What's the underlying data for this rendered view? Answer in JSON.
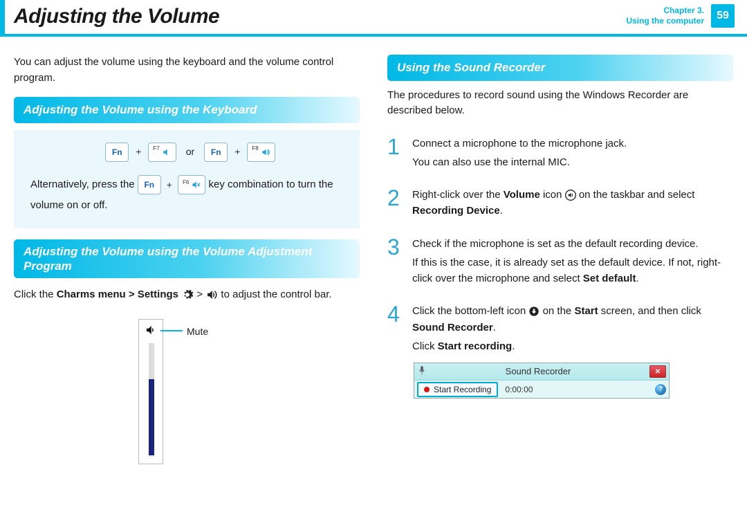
{
  "header": {
    "title": "Adjusting the Volume",
    "chapter_line1": "Chapter 3.",
    "chapter_line2": "Using the computer",
    "page_number": "59"
  },
  "left": {
    "intro": "You can adjust the volume using the keyboard and the volume control program.",
    "section1_title": "Adjusting the Volume using the Keyboard",
    "fn_label": "Fn",
    "f7_label": "F7",
    "f8_label": "F8",
    "f6_label": "F6",
    "or_label": "or",
    "plus": "+",
    "alt_prefix": "Alternatively, press the",
    "alt_suffix": "key combination to turn the volume on or off.",
    "section2_title": "Adjusting the Volume using the Volume Adjustment Program",
    "charms_prefix": "Click the ",
    "charms_bold": "Charms menu > Settings",
    "charms_sep": " > ",
    "charms_suffix": " to adjust the control bar.",
    "mute_label": "Mute"
  },
  "right": {
    "section_title": "Using the Sound Recorder",
    "intro": "The procedures to record sound using the Windows Recorder are described below.",
    "steps": {
      "s1_num": "1",
      "s1a": "Connect a microphone to the microphone jack.",
      "s1b": "You can also use the internal MIC.",
      "s2_num": "2",
      "s2_pre": "Right-click over the ",
      "s2_bold1": "Volume",
      "s2_mid": " icon ",
      "s2_post": " on the taskbar and select ",
      "s2_bold2": "Recording Device",
      "s2_end": ".",
      "s3_num": "3",
      "s3a": "Check if the microphone is set as the default recording device.",
      "s3b_pre": "If this is the case, it is already set as the default device. If not, right-click over the microphone and select ",
      "s3b_bold": "Set default",
      "s3b_end": ".",
      "s4_num": "4",
      "s4a_pre": "Click the bottom-left icon ",
      "s4a_mid": " on the ",
      "s4a_bold1": "Start",
      "s4a_post": " screen, and then click ",
      "s4a_bold2": "Sound Recorder",
      "s4a_end": ".",
      "s4b_pre": "Click ",
      "s4b_bold": "Start recording",
      "s4b_end": "."
    },
    "recorder": {
      "title": "Sound Recorder",
      "start_label": "Start Recording",
      "time": "0:00:00",
      "close_glyph": "✕",
      "help_glyph": "?"
    }
  }
}
